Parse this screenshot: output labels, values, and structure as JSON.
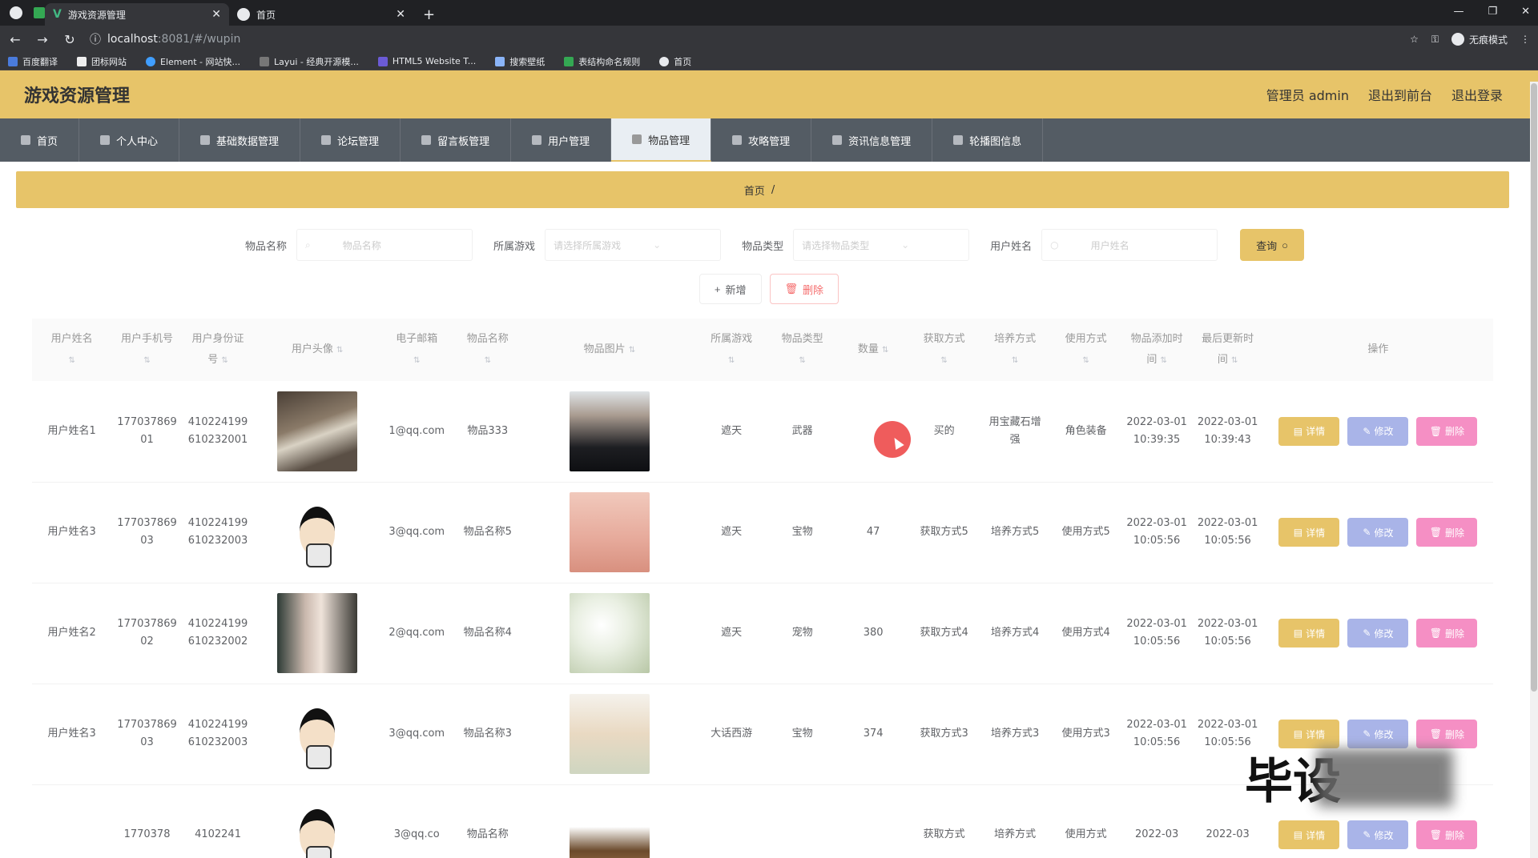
{
  "browser": {
    "tabs": [
      {
        "title": "游戏资源管理",
        "active": true
      },
      {
        "title": "首页",
        "active": false
      }
    ],
    "url_host": "localhost",
    "url_rest": ":8081/#/wupin",
    "incognito_label": "无痕模式",
    "bookmarks": [
      "百度翻译",
      "团标网站",
      "Element - 网站快...",
      "Layui - 经典开源模...",
      "HTML5 Website T...",
      "搜索壁纸",
      "表结构命名规则",
      "首页"
    ]
  },
  "header": {
    "title": "游戏资源管理",
    "admin": "管理员 admin",
    "to_front": "退出到前台",
    "logout": "退出登录"
  },
  "nav": [
    "首页",
    "个人中心",
    "基础数据管理",
    "论坛管理",
    "留言板管理",
    "用户管理",
    "物品管理",
    "攻略管理",
    "资讯信息管理",
    "轮播图信息"
  ],
  "nav_active_index": 6,
  "breadcrumb": {
    "home": "首页",
    "sep": "/",
    "current": ""
  },
  "search": {
    "fields": [
      {
        "label": "物品名称",
        "placeholder": "物品名称"
      },
      {
        "label": "所属游戏",
        "placeholder": "请选择所属游戏"
      },
      {
        "label": "物品类型",
        "placeholder": "请选择物品类型"
      },
      {
        "label": "用户姓名",
        "placeholder": "用户姓名"
      }
    ],
    "button": "查询"
  },
  "actions": {
    "add": "新增",
    "delete": "删除"
  },
  "table": {
    "columns": [
      "用户姓名",
      "用户手机号",
      "用户身份证号",
      "用户头像",
      "电子邮箱",
      "物品名称",
      "物品图片",
      "所属游戏",
      "物品类型",
      "数量",
      "获取方式",
      "培养方式",
      "使用方式",
      "物品添加时间",
      "最后更新时间",
      "操作"
    ],
    "rows": [
      {
        "name": "用户姓名1",
        "phone": "17703786901",
        "idcard": "410224199610232001",
        "avatar": "cat",
        "email": "1@qq.com",
        "item": "物品333",
        "img": "man",
        "game": "遮天",
        "type": "武器",
        "qty": "",
        "obtain": "买的",
        "train": "用宝藏石增强",
        "use": "角色装备",
        "add_time": "2022-03-01 10:39:35",
        "update_time": "2022-03-01 10:39:43"
      },
      {
        "name": "用户姓名3",
        "phone": "17703786903",
        "idcard": "410224199610232003",
        "avatar": "cartoon",
        "email": "3@qq.com",
        "item": "物品名称5",
        "img": "pink",
        "game": "遮天",
        "type": "宝物",
        "qty": "47",
        "obtain": "获取方式5",
        "train": "培养方式5",
        "use": "使用方式5",
        "add_time": "2022-03-01 10:05:56",
        "update_time": "2022-03-01 10:05:56"
      },
      {
        "name": "用户姓名2",
        "phone": "17703786902",
        "idcard": "410224199610232002",
        "avatar": "woman",
        "email": "2@qq.com",
        "item": "物品名称4",
        "img": "flower",
        "game": "遮天",
        "type": "宠物",
        "qty": "380",
        "obtain": "获取方式4",
        "train": "培养方式4",
        "use": "使用方式4",
        "add_time": "2022-03-01 10:05:56",
        "update_time": "2022-03-01 10:05:56"
      },
      {
        "name": "用户姓名3",
        "phone": "17703786903",
        "idcard": "410224199610232003",
        "avatar": "cartoon",
        "email": "3@qq.com",
        "item": "物品名称3",
        "img": "desk",
        "game": "大话西游",
        "type": "宝物",
        "qty": "374",
        "obtain": "获取方式3",
        "train": "培养方式3",
        "use": "使用方式3",
        "add_time": "2022-03-01 10:05:56",
        "update_time": "2022-03-01 10:05:56"
      },
      {
        "name": "",
        "phone": "1770378",
        "idcard": "4102241",
        "avatar": "cartoon",
        "email": "3@qq.co",
        "item": "物品名称",
        "img": "food",
        "game": "",
        "type": "",
        "qty": "",
        "obtain": "获取方式",
        "train": "培养方式",
        "use": "使用方式",
        "add_time": "2022-03",
        "update_time": "2022-03"
      }
    ],
    "op_labels": {
      "detail": "详情",
      "edit": "修改",
      "remove": "删除"
    }
  },
  "watermark": "毕设",
  "colors": {
    "accent": "#e7c469",
    "nav_bg": "#545c64",
    "edit": "#a9b4e8",
    "remove": "#f58fc4"
  }
}
